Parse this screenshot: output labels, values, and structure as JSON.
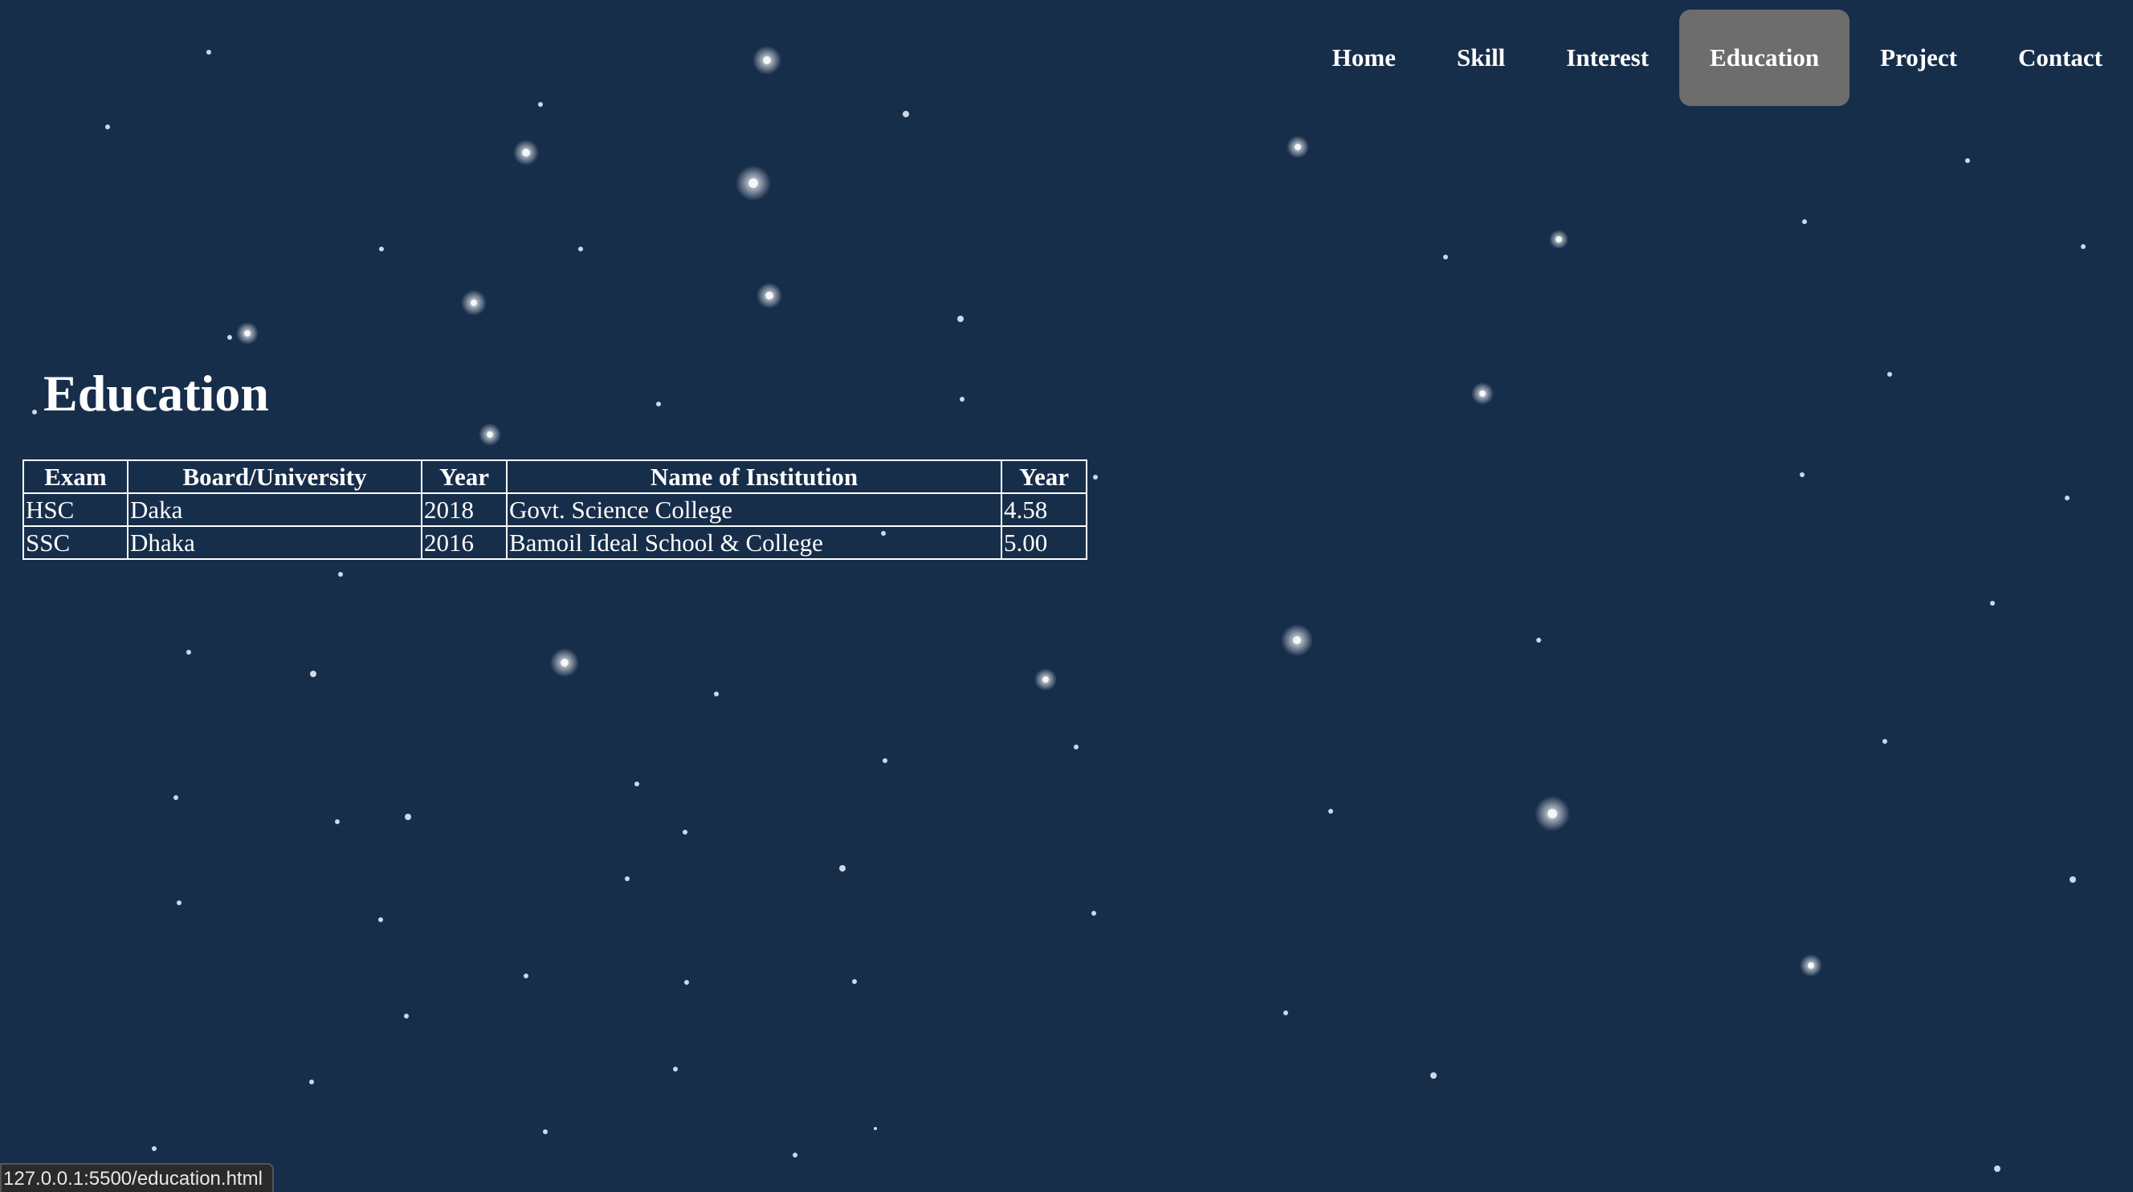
{
  "nav": {
    "items": [
      {
        "label": "Home"
      },
      {
        "label": "Skill"
      },
      {
        "label": "Interest"
      },
      {
        "label": "Education",
        "active": true
      },
      {
        "label": "Project"
      },
      {
        "label": "Contact"
      }
    ],
    "active_bg": "#6d6d6d"
  },
  "page": {
    "title": "Education",
    "background_color": "#172e4b",
    "background_decoration": "starfield"
  },
  "table": {
    "headers": [
      "Exam",
      "Board/University",
      "Year",
      "Name of Institution",
      "Year"
    ],
    "rows": [
      [
        "HSC",
        "Daka",
        "2018",
        "Govt. Science College",
        "4.58"
      ],
      [
        "SSC",
        "Dhaka",
        "2016",
        "Bamoil Ideal School & College",
        "5.00"
      ]
    ]
  },
  "status_bar": {
    "url": "127.0.0.1:5500/education.html"
  }
}
